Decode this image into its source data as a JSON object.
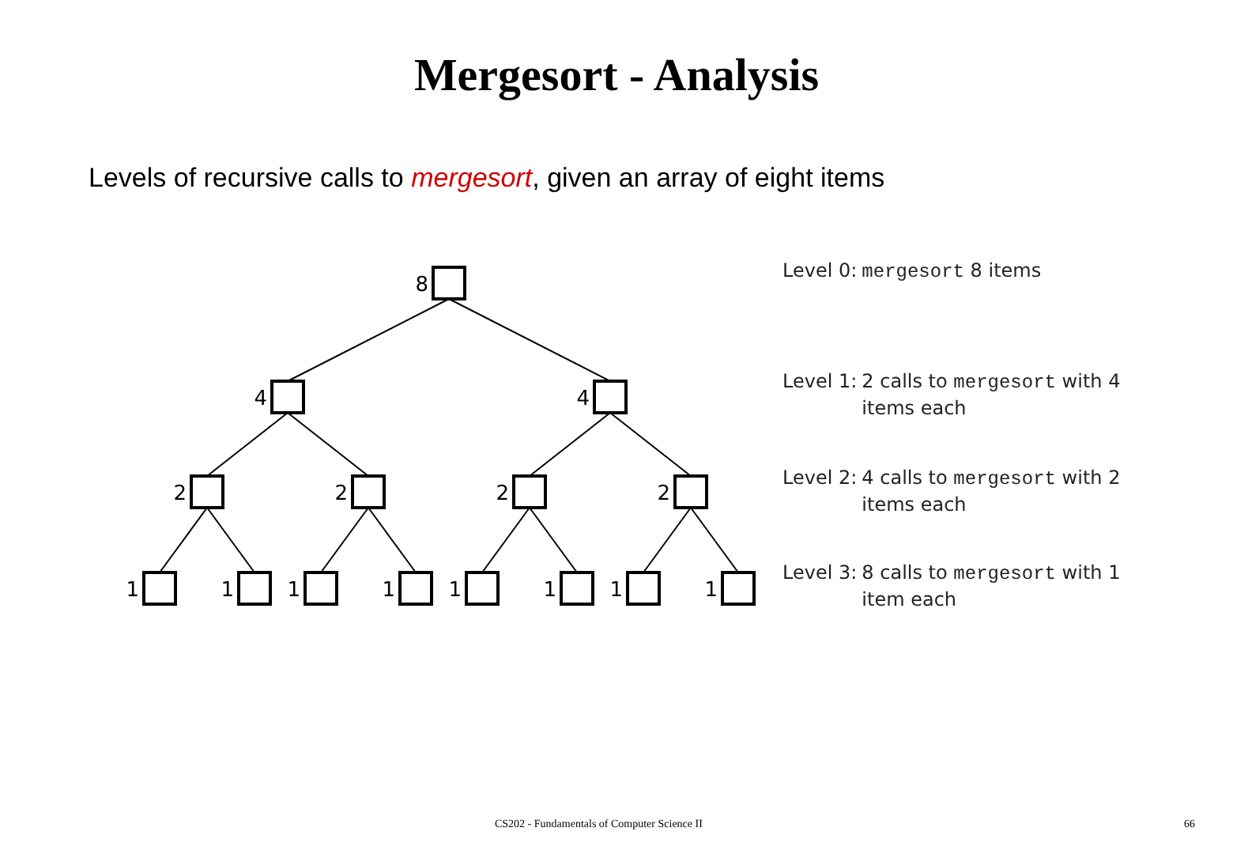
{
  "title": "Mergesort - Analysis",
  "subtitle": [
    {
      "kind": "plain",
      "text": "Levels of recursive calls to "
    },
    {
      "kind": "emphasis",
      "text": "mergesort"
    },
    {
      "kind": "plain",
      "text": ", given an array of eight items"
    }
  ],
  "tree": {
    "label": "8",
    "children": [
      {
        "label": "4",
        "children": [
          {
            "label": "2",
            "children": [
              {
                "label": "1"
              },
              {
                "label": "1"
              }
            ]
          },
          {
            "label": "2",
            "children": [
              {
                "label": "1"
              },
              {
                "label": "1"
              }
            ]
          }
        ]
      },
      {
        "label": "4",
        "children": [
          {
            "label": "2",
            "children": [
              {
                "label": "1"
              },
              {
                "label": "1"
              }
            ]
          },
          {
            "label": "2",
            "children": [
              {
                "label": "1"
              },
              {
                "label": "1"
              }
            ]
          }
        ]
      }
    ]
  },
  "levels": [
    {
      "prefix": "Level 0:",
      "lines": [
        [
          {
            "kind": "code",
            "text": "mergesort"
          },
          {
            "kind": "plain",
            "text": " 8 items"
          }
        ]
      ]
    },
    {
      "prefix": "Level 1:",
      "lines": [
        [
          {
            "kind": "plain",
            "text": "2 calls to "
          },
          {
            "kind": "code",
            "text": "mergesort"
          },
          {
            "kind": "plain",
            "text": " with 4"
          }
        ],
        [
          {
            "kind": "plain",
            "text": "items each"
          }
        ]
      ]
    },
    {
      "prefix": "Level 2:",
      "lines": [
        [
          {
            "kind": "plain",
            "text": "4 calls to "
          },
          {
            "kind": "code",
            "text": "mergesort"
          },
          {
            "kind": "plain",
            "text": " with 2"
          }
        ],
        [
          {
            "kind": "plain",
            "text": "items each"
          }
        ]
      ]
    },
    {
      "prefix": "Level 3:",
      "lines": [
        [
          {
            "kind": "plain",
            "text": "8 calls to "
          },
          {
            "kind": "code",
            "text": "mergesort"
          },
          {
            "kind": "plain",
            "text": " with 1"
          }
        ],
        [
          {
            "kind": "plain",
            "text": "item each"
          }
        ]
      ]
    }
  ],
  "footer": {
    "course": "CS202 - Fundamentals of Computer Science II",
    "page": "66"
  }
}
